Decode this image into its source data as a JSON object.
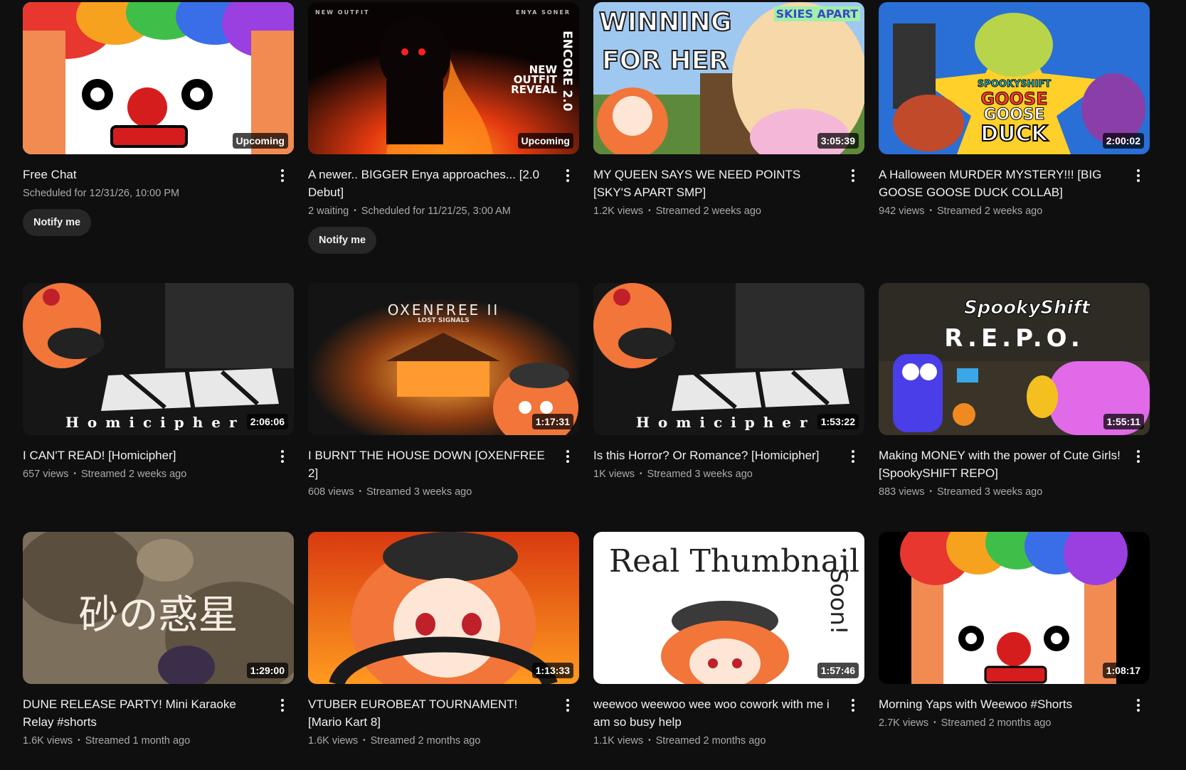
{
  "videos": [
    {
      "title": "Free Chat",
      "badge": "Upcoming",
      "views": "",
      "age": "",
      "scheduled": "Scheduled for 12/31/26, 10:00 PM",
      "notify": "Notify me",
      "thumb_text": ""
    },
    {
      "title": "A newer.. BIGGER Enya approaches... [2.0 Debut]",
      "badge": "Upcoming",
      "views": "2 waiting",
      "age": "",
      "scheduled": "Scheduled for 11/21/25, 3:00 AM",
      "notify": "Notify me",
      "thumb_text": "NEW OUTFIT REVEAL",
      "thumb_text2": "ENCORE 2.0",
      "thumb_text3": "NEW OUTFIT",
      "thumb_text4": "ENYA SONER"
    },
    {
      "title": "MY QUEEN SAYS WE NEED POINTS [SKY'S APART SMP]",
      "badge": "3:05:39",
      "views": "1.2K views",
      "age": "Streamed 2 weeks ago",
      "thumb_text": "WINNING",
      "thumb_text2": "FOR HER",
      "thumb_text3": "SKIES APART"
    },
    {
      "title": "A Halloween MURDER MYSTERY!!! [BIG GOOSE GOOSE DUCK COLLAB]",
      "badge": "2:00:02",
      "views": "942 views",
      "age": "Streamed 2 weeks ago",
      "thumb_text": "SPOOKYSHIFT",
      "thumb_text2": "GOOSE",
      "thumb_text3": "GOOSE",
      "thumb_text4": "DUCK"
    },
    {
      "title": "I CAN'T READ! [Homicipher]",
      "badge": "2:06:06",
      "views": "657 views",
      "age": "Streamed 2 weeks ago",
      "thumb_text": "Homicipher"
    },
    {
      "title": "I BURNT THE HOUSE DOWN [OXENFREE 2]",
      "badge": "1:17:31",
      "views": "608 views",
      "age": "Streamed 3 weeks ago",
      "thumb_text": "OXENFREE II",
      "thumb_text2": "LOST SIGNALS"
    },
    {
      "title": "Is this Horror? Or Romance? [Homicipher]",
      "badge": "1:53:22",
      "views": "1K views",
      "age": "Streamed 3 weeks ago",
      "thumb_text": "Homicipher"
    },
    {
      "title": "Making MONEY with the power of Cute Girls! [SpookySHIFT REPO]",
      "badge": "1:55:11",
      "views": "883 views",
      "age": "Streamed 3 weeks ago",
      "thumb_text": "SpookyShift",
      "thumb_text2": "R.E.P.O."
    },
    {
      "title": "DUNE RELEASE PARTY! Mini Karaoke Relay #shorts",
      "badge": "1:29:00",
      "views": "1.6K views",
      "age": "Streamed 1 month ago",
      "thumb_text": "砂の惑星"
    },
    {
      "title": "VTUBER EUROBEAT TOURNAMENT! [Mario Kart 8]",
      "badge": "1:13:33",
      "views": "1.6K views",
      "age": "Streamed 2 months ago",
      "thumb_text": ""
    },
    {
      "title": "weewoo weewoo wee woo cowork with me i am so busy help",
      "badge": "1:57:46",
      "views": "1.1K views",
      "age": "Streamed 2 months ago",
      "thumb_text": "Real Thumbnail",
      "thumb_text2": "Soon!"
    },
    {
      "title": "Morning Yaps with Weewoo #Shorts",
      "badge": "1:08:17",
      "views": "2.7K views",
      "age": "Streamed 2 months ago",
      "thumb_text": ""
    }
  ],
  "colors": {
    "background": "#0f0f0f",
    "text": "#f1f1f1",
    "secondary": "#aaaaaa",
    "button": "#272727"
  }
}
